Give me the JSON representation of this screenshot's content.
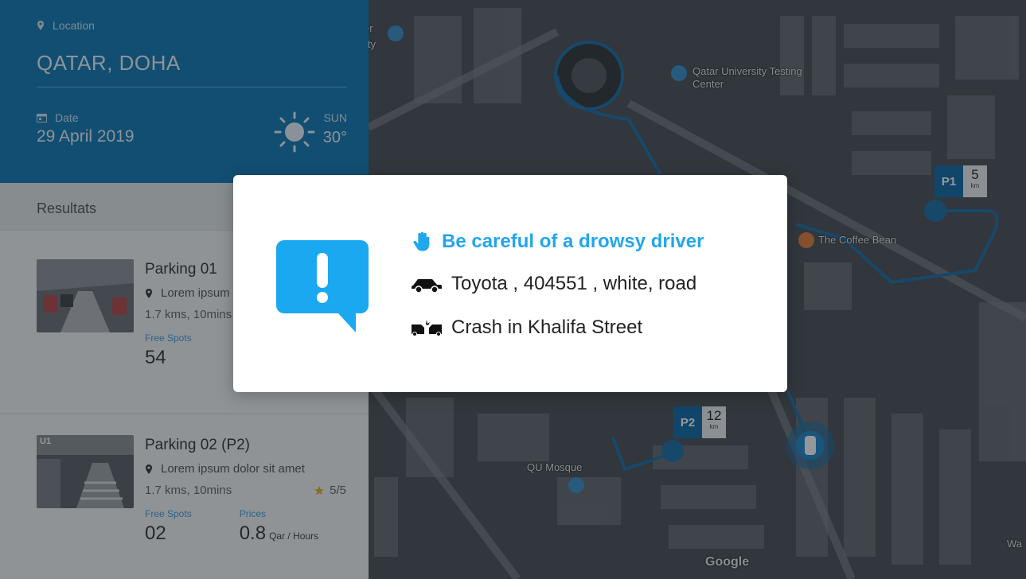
{
  "location": {
    "label": "Location",
    "value": "QATAR, DOHA"
  },
  "date": {
    "label": "Date",
    "value": "29 April 2019"
  },
  "weather": {
    "day": "SUN",
    "temp": "30°"
  },
  "results": {
    "title": "Resultats"
  },
  "parkings": [
    {
      "title": "Parking 01",
      "address": "Lorem ipsum dolor sit amet",
      "distance": "1.7 kms, 10mins",
      "free_spots_label": "Free Spots",
      "free_spots": "54"
    },
    {
      "thumb_label": "U1",
      "title": "Parking 02 (P2)",
      "address": "Lorem ipsum dolor sit amet",
      "distance": "1.7 kms, 10mins",
      "rating": "5/5",
      "free_spots_label": "Free Spots",
      "free_spots": "02",
      "prices_label": "Prices",
      "price": "0.8",
      "price_unit": "Qar / Hours"
    }
  ],
  "map": {
    "places": [
      "Qatar University Testing Center",
      "The Coffee Bean",
      "QU Mosque"
    ],
    "badges": [
      {
        "label": "P1",
        "distance": "5",
        "unit": "km"
      },
      {
        "label": "P2",
        "distance": "12",
        "unit": "km"
      }
    ],
    "attribution": "Google",
    "partial_labels": [
      "er",
      "ity",
      "Wa"
    ]
  },
  "alert": {
    "title": "Be careful of a drowsy driver",
    "vehicle": "Toyota , 404551 , white, road",
    "incident": "Crash in Khalifa Street"
  },
  "colors": {
    "primary": "#1178b6",
    "accent": "#22a6ee",
    "alert_icon": "#1aa8f0"
  }
}
